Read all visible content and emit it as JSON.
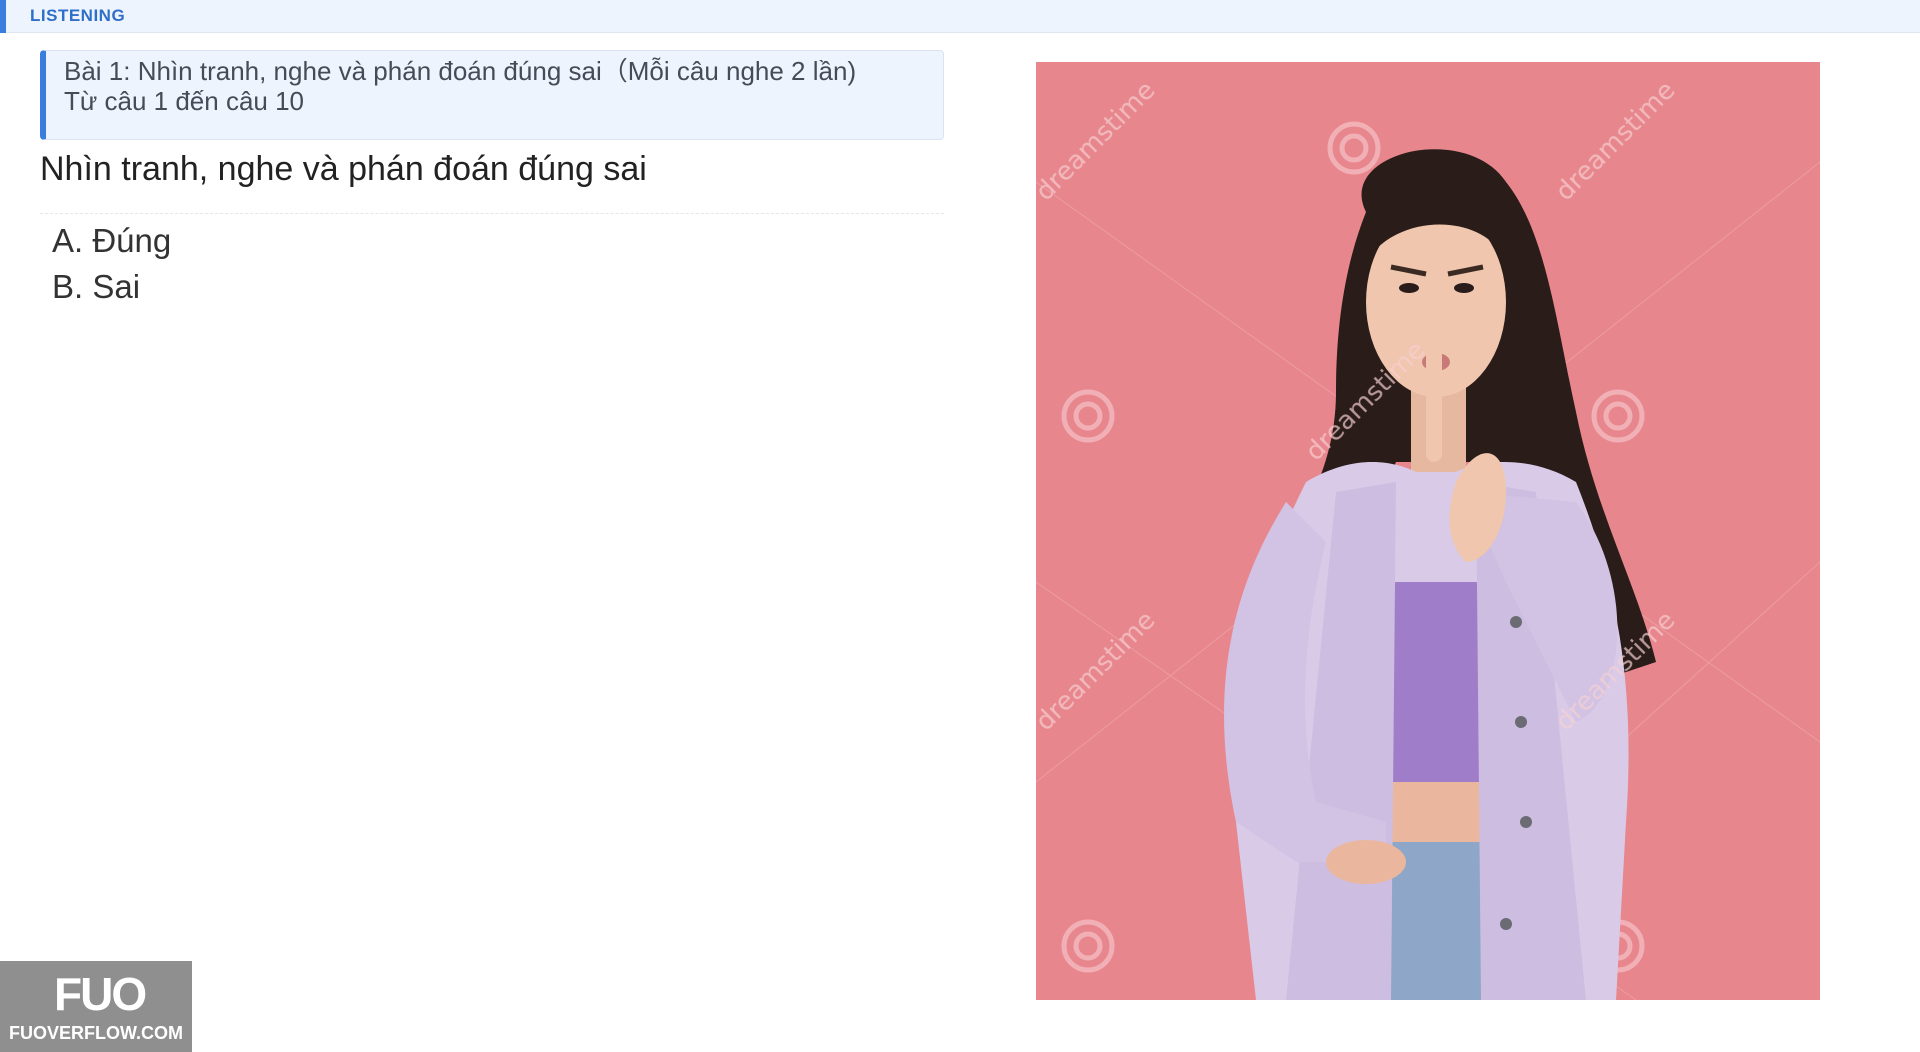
{
  "header": {
    "section_label": "LISTENING",
    "accent_color": "#3b7ddd"
  },
  "instruction": {
    "line1": "Bài 1: Nhìn tranh, nghe và phán đoán đúng sai（Mỗi câu nghe 2 lần)",
    "line2": "Từ câu 1 đến câu 10"
  },
  "question": {
    "title": "Nhìn tranh, nghe và phán đoán đúng sai",
    "options": [
      {
        "label": "A. Đúng"
      },
      {
        "label": "B. Sai"
      }
    ]
  },
  "image": {
    "description_icon": "woman-shush-photo",
    "background_color": "#e8868d",
    "stock_watermark": "dreamstime"
  },
  "site_watermark": {
    "mark": "FUO",
    "url": "FUOVERFLOW.COM"
  }
}
